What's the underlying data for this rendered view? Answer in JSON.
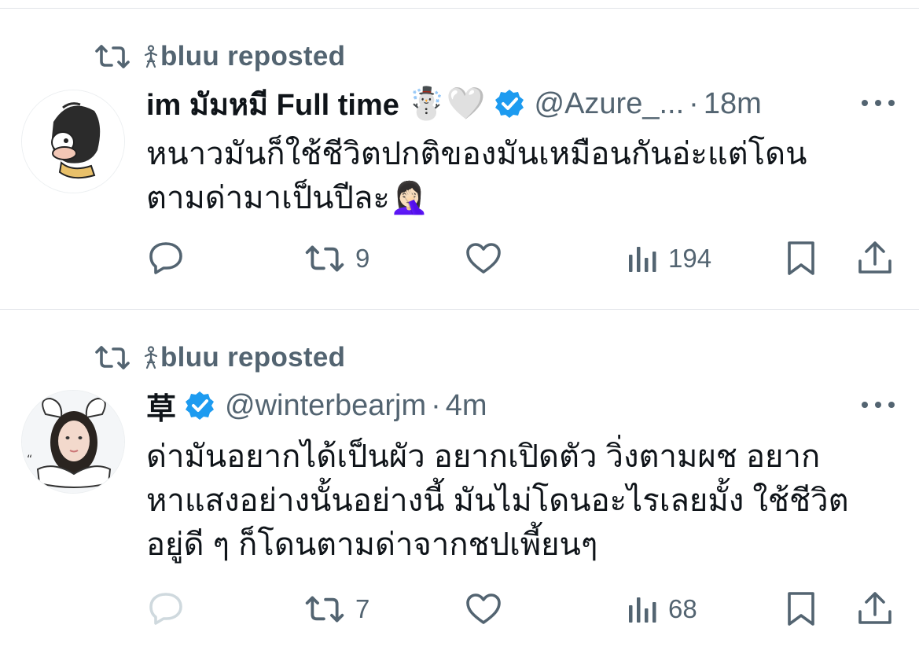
{
  "colors": {
    "text": "#0f1419",
    "secondary": "#536471",
    "verified": "#1d9bf0",
    "divider": "#e1e4e8"
  },
  "tweets": [
    {
      "repost_label": "bluu reposted",
      "name": "im มัมหมี Full time",
      "name_emojis": "☃️🤍",
      "verified": true,
      "handle": "@Azure_...",
      "separator": "·",
      "time": "18m",
      "text_lines": [
        "หนาวมันก็ใช้ชีวิตปกติของมันเหมือนกันอ่ะแต่โดน",
        "ตามด่ามาเป็นปีละ🤦🏻‍♀️"
      ],
      "actions": {
        "reply_count": "",
        "retweet_count": "9",
        "like_count": "",
        "views_count": "194"
      },
      "icons": [
        "repost-icon",
        "person-icon",
        "verified-badge-icon",
        "more-icon",
        "reply-icon",
        "retweet-icon",
        "like-icon",
        "views-icon",
        "bookmark-icon",
        "share-icon"
      ]
    },
    {
      "repost_label": "bluu reposted",
      "name": "草",
      "name_emojis": "",
      "verified": true,
      "handle": "@winterbearjm",
      "separator": "·",
      "time": "4m",
      "text_lines": [
        "ด่ามันอยากได้เป็นผัว อยากเปิดตัว วิ่งตามผช อยาก",
        "หาแสงอย่างนั้นอย่างนี้ มันไม่โดนอะไรเลยมั้ง ใช้ชีวิต",
        "อยู่ดี ๆ ก็โดนตามด่าจากชปเพี้ยนๆ"
      ],
      "actions": {
        "reply_count": "",
        "retweet_count": "7",
        "like_count": "",
        "views_count": "68"
      },
      "icons": [
        "repost-icon",
        "person-icon",
        "verified-badge-icon",
        "more-icon",
        "reply-icon",
        "retweet-icon",
        "like-icon",
        "views-icon",
        "bookmark-icon",
        "share-icon"
      ]
    }
  ]
}
